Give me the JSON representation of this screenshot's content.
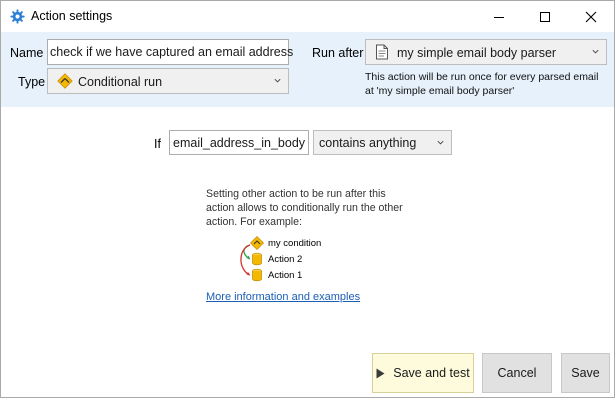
{
  "window": {
    "title": "Action settings",
    "title_icon": "gear-icon"
  },
  "header": {
    "name_label": "Name",
    "name_value": "check if we have captured an email address",
    "type_label": "Type",
    "type_value": "Conditional run",
    "run_after_label": "Run after",
    "run_after_value": "my simple email body parser",
    "info_text": "This action will be run once for every parsed email at 'my simple email body parser'"
  },
  "condition": {
    "if_label": "If",
    "field_value": "email_address_in_body",
    "operator_value": "contains anything"
  },
  "help": {
    "text": "Setting other action to be run after this action allows to conditionally run the other action. For example:",
    "example_items": [
      "my condition",
      "Action 2",
      "Action 1"
    ],
    "link_text": "More information and examples"
  },
  "buttons": {
    "save_and_test": "Save and test",
    "cancel": "Cancel",
    "save": "Save"
  },
  "colors": {
    "header_bg": "#e6f1fb",
    "link": "#1b5fb4",
    "save_test_bg": "#fdfbdc",
    "gear": "#2a7fd4",
    "condition_icon": "#f5b800"
  }
}
